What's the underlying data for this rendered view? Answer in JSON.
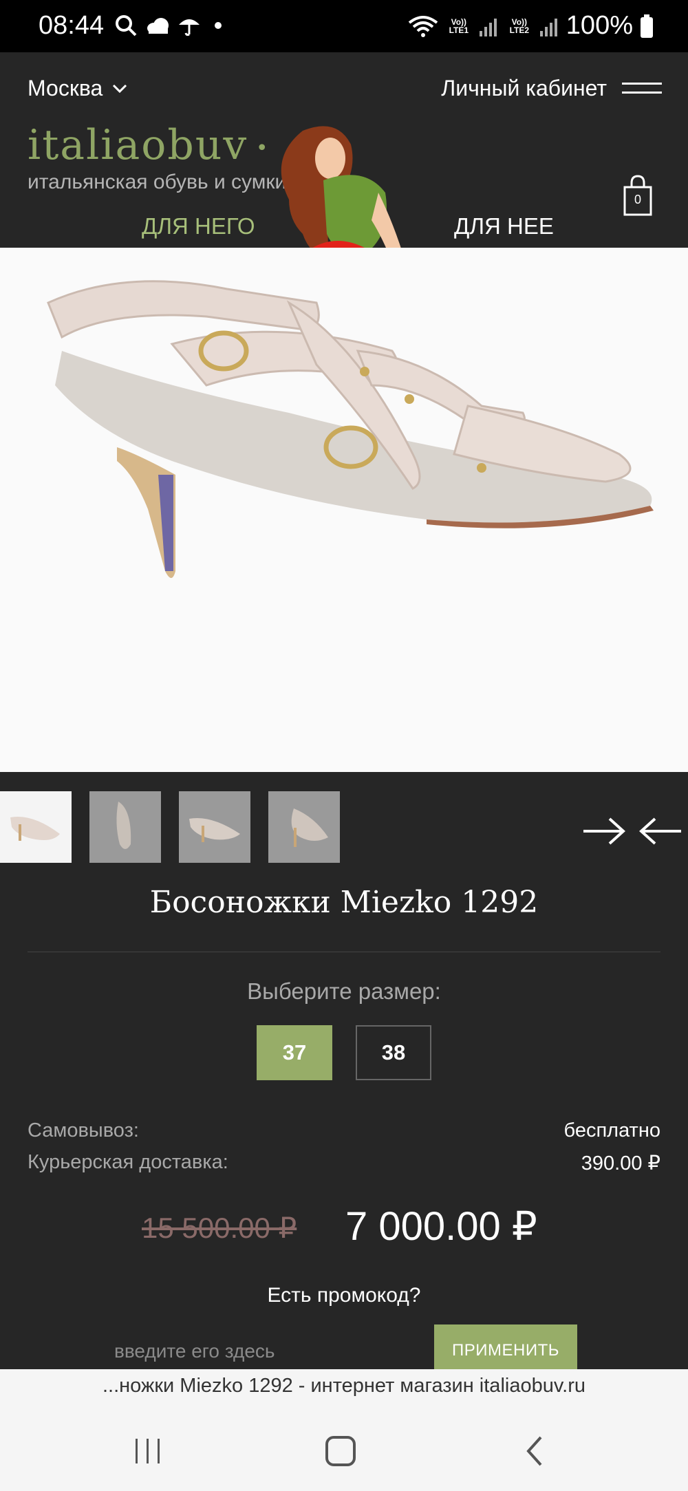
{
  "status_bar": {
    "time": "08:44",
    "battery": "100%",
    "sim1": "Vo)) LTE1",
    "sim2": "Vo)) LTE2"
  },
  "header": {
    "city": "Москва",
    "account": "Личный кабинет",
    "logo": "italiaobuv",
    "tagline": "итальянская обувь и сумки",
    "cart_count": "0",
    "nav_him": "ДЛЯ НЕГО",
    "nav_her": "ДЛЯ НЕЕ"
  },
  "product": {
    "title": "Босоножки Miezko 1292",
    "size_label": "Выберите размер:",
    "sizes": [
      "37",
      "38"
    ],
    "selected_size": "37",
    "pickup_label": "Самовывоз:",
    "pickup_value": "бесплатно",
    "courier_label": "Курьерская доставка:",
    "courier_value": "390.00 ₽",
    "old_price": "15 500.00 ₽",
    "new_price": "7 000.00 ₽",
    "promo_question": "Есть промокод?",
    "promo_placeholder": "введите его здесь",
    "apply_label": "ПРИМЕНИТЬ"
  },
  "browser": {
    "url_title": "...ножки Miezko 1292 - интернет магазин italiaobuv.ru"
  },
  "colors": {
    "accent_green": "#97ad68",
    "background": "#262626",
    "old_price": "#8a6a68"
  }
}
